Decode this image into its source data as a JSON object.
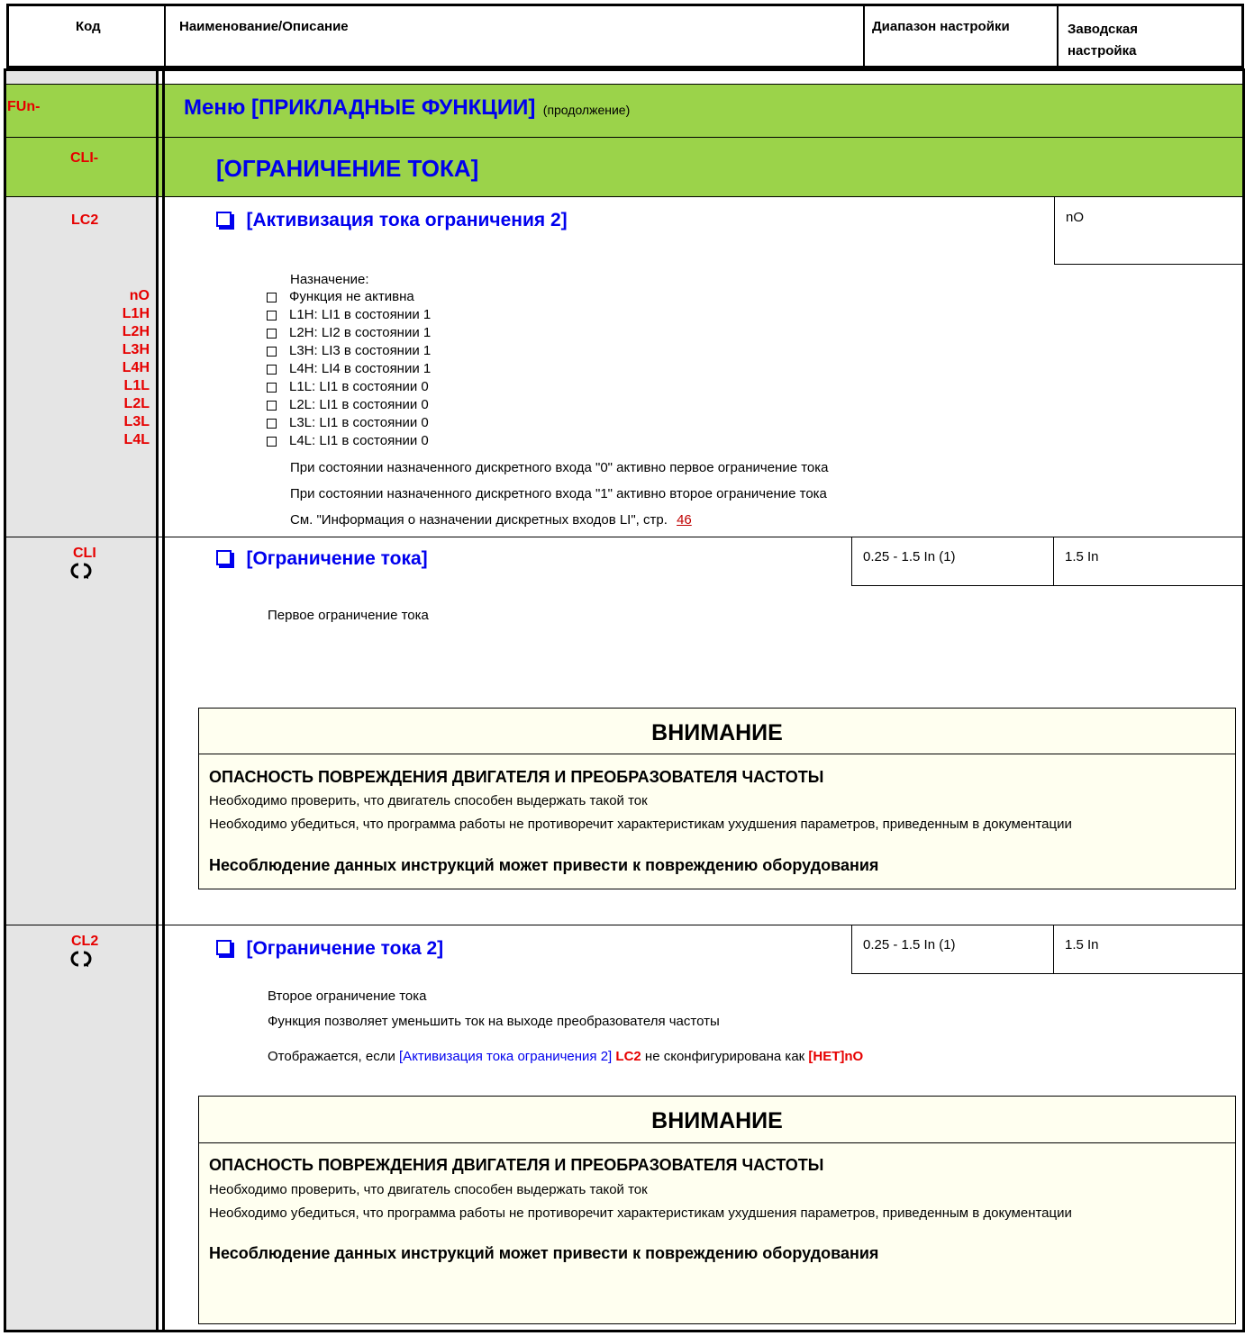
{
  "header": {
    "col_code": "Код",
    "col_name": "Наименование/Описание",
    "col_range": "Диапазон настройки",
    "col_factory": "Заводская настройка"
  },
  "menu": {
    "code": "FUn-",
    "title": "Меню [ПРИКЛАДНЫЕ ФУНКЦИИ]",
    "continued": "(продолжение)"
  },
  "submenu": {
    "code": "CLI-",
    "title": "[ОГРАНИЧЕНИЕ ТОКА]"
  },
  "lc2": {
    "code": "LC2",
    "title": "[Активизация тока ограничения 2]",
    "factory": "nO",
    "assignment_label": "Назначение:",
    "options": [
      {
        "code": "nO",
        "text": "Функция не активна"
      },
      {
        "code": "L1H",
        "text": "L1H: LI1 в состоянии 1"
      },
      {
        "code": "L2H",
        "text": "L2H: LI2 в состоянии 1"
      },
      {
        "code": "L3H",
        "text": "L3H: LI3 в состоянии 1"
      },
      {
        "code": "L4H",
        "text": "L4H: LI4 в состоянии 1"
      },
      {
        "code": "L1L",
        "text": "L1L: LI1 в состоянии 0"
      },
      {
        "code": "L2L",
        "text": "L2L: LI1 в состоянии 0"
      },
      {
        "code": "L3L",
        "text": "L3L: LI1 в состоянии 0"
      },
      {
        "code": "L4L",
        "text": "L4L: LI1 в состоянии 0"
      }
    ],
    "note1": "При состоянии назначенного дискретного входа \"0\" активно первое ограничение тока",
    "note2": "При состоянии назначенного дискретного входа \"1\" активно второе ограничение тока",
    "note3": "См. \"Информация о назначении дискретных входов LI\", стр.",
    "page_link": "46"
  },
  "cli": {
    "code": "CLI",
    "title": "[Ограничение тока]",
    "range": "0.25 - 1.5 In (1)",
    "factory": "1.5 In",
    "desc": "Первое ограничение тока"
  },
  "cl2": {
    "code": "CL2",
    "title": "[Ограничение тока 2]",
    "range": "0.25 - 1.5 In (1)",
    "factory": "1.5 In",
    "desc1": "Второе ограничение тока",
    "desc2": "Функция позволяет уменьшить  ток на выходе преобразователя частоты",
    "visible_prefix": "Отображается, если",
    "visible_param": "[Активизация тока ограничения 2]",
    "visible_code": "LC2",
    "visible_mid": "не сконфигурирована как",
    "visible_value": "[НЕТ]nO"
  },
  "warning": {
    "title": "ВНИМАНИЕ",
    "heading": "ОПАСНОСТЬ ПОВРЕЖДЕНИЯ ДВИГАТЕЛЯ И ПРЕОБРАЗОВАТЕЛЯ ЧАСТОТЫ",
    "line1": "Необходимо проверить, что двигатель способен выдержать такой ток",
    "line2": "Необходимо убедиться, что программа работы не противоречит характеристикам ухудшения параметров, приведенным в документации",
    "footer": "Несоблюдение данных инструкций может привести к повреждению оборудования"
  },
  "icons": {
    "parameter_bullet": "square-bullet-icon",
    "option_checkbox": "checkbox-icon",
    "adjustable": "rotate-arrows-icon"
  },
  "colors": {
    "code_red": "#e60000",
    "title_blue": "#0000ee",
    "menu_green": "#9bd34a",
    "code_column_gray": "#e5e5e5",
    "warning_bg": "#fffff0"
  }
}
